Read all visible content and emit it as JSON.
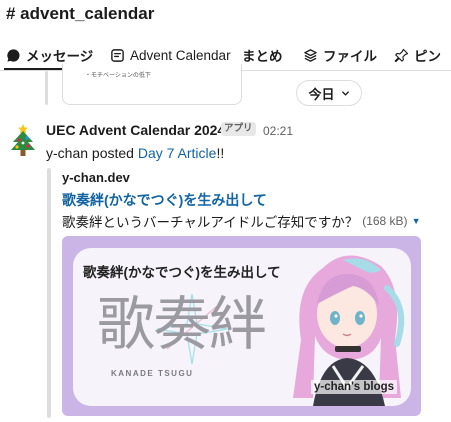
{
  "header": {
    "channel": "# advent_calendar",
    "tabs": [
      {
        "label": "メッセージ",
        "icon": "message-bubble-icon"
      },
      {
        "label": "Advent Calendar",
        "icon": "canvas-doc-icon"
      },
      {
        "label": "まとめ",
        "icon": ""
      },
      {
        "label": "ファイル",
        "icon": "layers-icon"
      },
      {
        "label": "ピン",
        "icon": "pin-icon"
      }
    ]
  },
  "previous": {
    "snippet": "・モチベーションの低下"
  },
  "date_divider": {
    "label": "今日"
  },
  "message": {
    "avatar": "christmas-tree-icon",
    "sender": "UEC Advent Calendar 2024",
    "badge": "アプリ",
    "time": "02:21",
    "text_prefix": "y-chan posted ",
    "link_text": "Day 7 Article",
    "text_suffix": "!!",
    "attachment": {
      "site": "y-chan.dev",
      "title": "歌奏絆(かなでつぐ)を生み出して",
      "description": "歌奏絆というバーチャルアイドルご存知ですか？",
      "size": "(168 kB)",
      "preview": {
        "heading": "歌奏絆(かなでつぐ)を生み出して",
        "logo_kanji": "歌奏絆",
        "logo_romaji": "KANADE TSUGU",
        "blog_label": "y-chan's blogs"
      }
    }
  },
  "colors": {
    "link": "#1264a3",
    "preview_frame": "#cab5e6",
    "text": "#1d1c1d"
  }
}
